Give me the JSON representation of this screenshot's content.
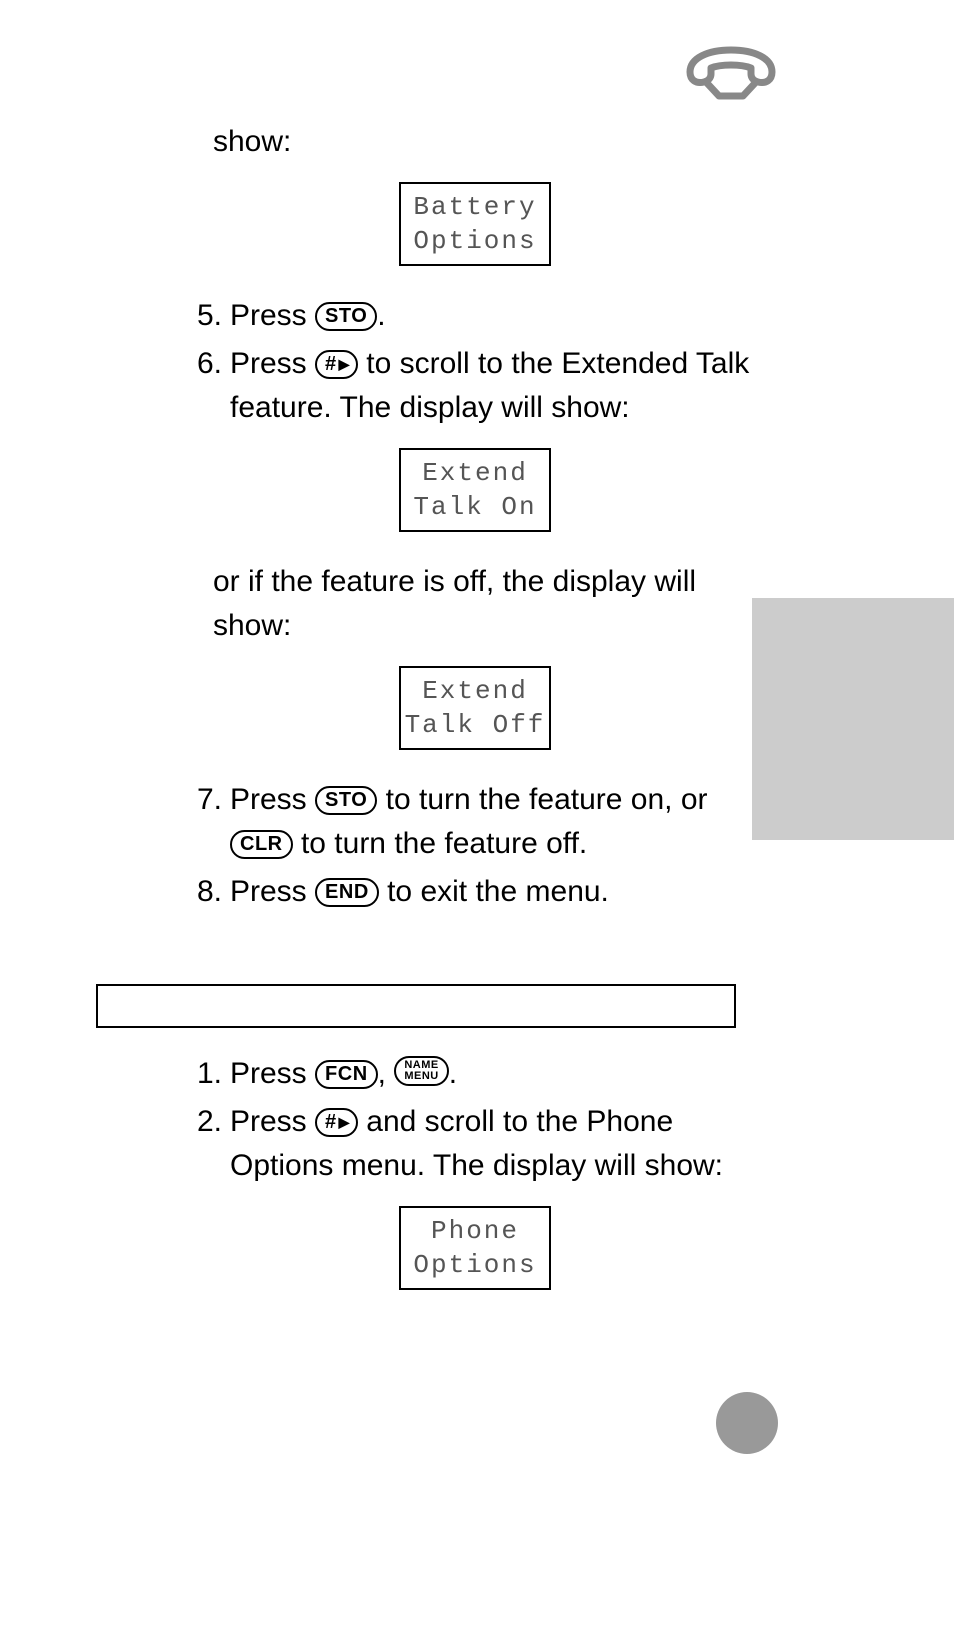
{
  "lead_in": "show:",
  "display1_line1": "Battery",
  "display1_line2": "Options",
  "steps_a": {
    "5": {
      "num": "5.",
      "pre": "Press ",
      "key": "STO",
      "post": "."
    },
    "6": {
      "num": "6.",
      "pre": "Press ",
      "key": "#",
      "post": " to scroll to the Extended Talk feature. The display will show:"
    }
  },
  "display2_line1": "Extend",
  "display2_line2": "Talk On",
  "cont1": "or if the feature is off, the display will show:",
  "display3_line1": "Extend",
  "display3_line2": "Talk Off",
  "steps_b": {
    "7": {
      "num": "7.",
      "pre": "Press ",
      "key1": "STO",
      "mid": " to turn the feature on, or ",
      "key2": "CLR",
      "post": " to turn the feature off."
    },
    "8": {
      "num": "8.",
      "pre": "Press ",
      "key": "END",
      "post": " to exit the menu."
    }
  },
  "steps_c": {
    "1": {
      "num": "1.",
      "pre": "Press ",
      "key1": "FCN",
      "mid": ", ",
      "key2_l1": "NAME",
      "key2_l2": "MENU",
      "post": "."
    },
    "2": {
      "num": "2.",
      "pre": "Press ",
      "key": "#",
      "post": " and scroll to the Phone Options menu. The display will show:"
    }
  },
  "display4_line1": "Phone",
  "display4_line2": "Options"
}
